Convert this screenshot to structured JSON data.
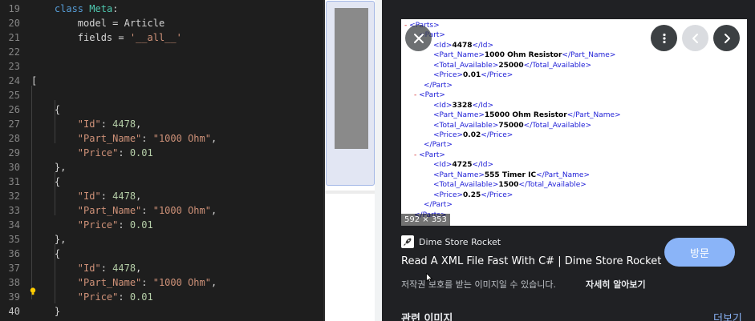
{
  "editor": {
    "lines": [
      {
        "no": "19",
        "indent": "    ",
        "tokens": [
          {
            "t": "class ",
            "c": "kw"
          },
          {
            "t": "Meta",
            "c": "cls"
          },
          {
            "t": ":",
            "c": ""
          }
        ]
      },
      {
        "no": "20",
        "indent": "        ",
        "tokens": [
          {
            "t": "model = Article",
            "c": ""
          }
        ]
      },
      {
        "no": "21",
        "indent": "        ",
        "tokens": [
          {
            "t": "fields = ",
            "c": ""
          },
          {
            "t": "'__all__'",
            "c": "str"
          }
        ]
      },
      {
        "no": "22",
        "indent": "",
        "tokens": []
      },
      {
        "no": "23",
        "indent": "",
        "tokens": []
      },
      {
        "no": "24",
        "indent": "",
        "tokens": [
          {
            "t": "[",
            "c": ""
          }
        ]
      },
      {
        "no": "25",
        "indent": "",
        "tokens": []
      },
      {
        "no": "26",
        "indent": "    ",
        "tokens": [
          {
            "t": "{",
            "c": ""
          }
        ]
      },
      {
        "no": "27",
        "indent": "        ",
        "tokens": [
          {
            "t": "\"Id\"",
            "c": "str"
          },
          {
            "t": ": ",
            "c": ""
          },
          {
            "t": "4478",
            "c": "num"
          },
          {
            "t": ",",
            "c": ""
          }
        ]
      },
      {
        "no": "28",
        "indent": "        ",
        "tokens": [
          {
            "t": "\"Part_Name\"",
            "c": "str"
          },
          {
            "t": ": ",
            "c": ""
          },
          {
            "t": "\"1000 Ohm\"",
            "c": "str"
          },
          {
            "t": ",",
            "c": ""
          }
        ]
      },
      {
        "no": "29",
        "indent": "        ",
        "tokens": [
          {
            "t": "\"Price\"",
            "c": "str"
          },
          {
            "t": ": ",
            "c": ""
          },
          {
            "t": "0.01",
            "c": "num"
          }
        ]
      },
      {
        "no": "30",
        "indent": "    ",
        "tokens": [
          {
            "t": "},",
            "c": ""
          }
        ]
      },
      {
        "no": "31",
        "indent": "    ",
        "tokens": [
          {
            "t": "{",
            "c": ""
          }
        ]
      },
      {
        "no": "32",
        "indent": "        ",
        "tokens": [
          {
            "t": "\"Id\"",
            "c": "str"
          },
          {
            "t": ": ",
            "c": ""
          },
          {
            "t": "4478",
            "c": "num"
          },
          {
            "t": ",",
            "c": ""
          }
        ]
      },
      {
        "no": "33",
        "indent": "        ",
        "tokens": [
          {
            "t": "\"Part_Name\"",
            "c": "str"
          },
          {
            "t": ": ",
            "c": ""
          },
          {
            "t": "\"1000 Ohm\"",
            "c": "str"
          },
          {
            "t": ",",
            "c": ""
          }
        ]
      },
      {
        "no": "34",
        "indent": "        ",
        "tokens": [
          {
            "t": "\"Price\"",
            "c": "str"
          },
          {
            "t": ": ",
            "c": ""
          },
          {
            "t": "0.01",
            "c": "num"
          }
        ]
      },
      {
        "no": "35",
        "indent": "    ",
        "tokens": [
          {
            "t": "},",
            "c": ""
          }
        ]
      },
      {
        "no": "36",
        "indent": "    ",
        "tokens": [
          {
            "t": "{",
            "c": ""
          }
        ]
      },
      {
        "no": "37",
        "indent": "        ",
        "tokens": [
          {
            "t": "\"Id\"",
            "c": "str"
          },
          {
            "t": ": ",
            "c": ""
          },
          {
            "t": "4478",
            "c": "num"
          },
          {
            "t": ",",
            "c": ""
          }
        ]
      },
      {
        "no": "38",
        "indent": "        ",
        "tokens": [
          {
            "t": "\"Part_Name\"",
            "c": "str"
          },
          {
            "t": ": ",
            "c": ""
          },
          {
            "t": "\"1000 Ohm\"",
            "c": "str"
          },
          {
            "t": ",",
            "c": ""
          }
        ]
      },
      {
        "no": "39",
        "indent": "        ",
        "tokens": [
          {
            "t": "\"Price\"",
            "c": "str"
          },
          {
            "t": ": ",
            "c": ""
          },
          {
            "t": "0.01",
            "c": "num"
          }
        ]
      },
      {
        "no": "40",
        "indent": "    ",
        "tokens": [
          {
            "t": "}",
            "c": ""
          }
        ]
      },
      {
        "no": "41",
        "indent": "",
        "tokens": [
          {
            "t": "]",
            "c": ""
          }
        ]
      }
    ],
    "active_line": "40",
    "colors": {
      "background": "#1e1e1e",
      "keyword": "#569cd6",
      "class": "#4ec9b0",
      "string": "#ce9178",
      "number": "#b5cea8"
    }
  },
  "preview": {
    "xml_lines": [
      {
        "dash": "- ",
        "open": "<Parts>",
        "value": "",
        "close": ""
      },
      {
        "dash": "- ",
        "open": "<Part>",
        "value": "",
        "close": ""
      },
      {
        "dash": "",
        "open": "<Id>",
        "value": "4478",
        "close": "</Id>"
      },
      {
        "dash": "",
        "open": "<Part_Name>",
        "value": "1000 Ohm Resistor",
        "close": "</Part_Name>"
      },
      {
        "dash": "",
        "open": "<Total_Available>",
        "value": "25000",
        "close": "</Total_Available>"
      },
      {
        "dash": "",
        "open": "<Price>",
        "value": "0.01",
        "close": "</Price>"
      },
      {
        "dash": "",
        "open": "</Part>",
        "value": "",
        "close": ""
      },
      {
        "dash": "- ",
        "open": "<Part>",
        "value": "",
        "close": ""
      },
      {
        "dash": "",
        "open": "<Id>",
        "value": "3328",
        "close": "</Id>"
      },
      {
        "dash": "",
        "open": "<Part_Name>",
        "value": "15000 Ohm Resistor",
        "close": "</Part_Name>"
      },
      {
        "dash": "",
        "open": "<Total_Available>",
        "value": "75000",
        "close": "</Total_Available>"
      },
      {
        "dash": "",
        "open": "<Price>",
        "value": "0.02",
        "close": "</Price>"
      },
      {
        "dash": "",
        "open": "</Part>",
        "value": "",
        "close": ""
      },
      {
        "dash": "- ",
        "open": "<Part>",
        "value": "",
        "close": ""
      },
      {
        "dash": "",
        "open": "<Id>",
        "value": "4725",
        "close": "</Id>"
      },
      {
        "dash": "",
        "open": "<Part_Name>",
        "value": "555 Timer IC",
        "close": "</Part_Name>"
      },
      {
        "dash": "",
        "open": "<Total_Available>",
        "value": "1500",
        "close": "</Total_Available>"
      },
      {
        "dash": "",
        "open": "<Price>",
        "value": "0.25",
        "close": "</Price>"
      },
      {
        "dash": "",
        "open": "</Part>",
        "value": "",
        "close": ""
      },
      {
        "dash": "",
        "open": "</Parts>",
        "value": "",
        "close": ""
      }
    ],
    "dimensions": "592 × 353"
  },
  "source": {
    "name": "Dime Store Rocket",
    "title": "Read A XML File Fast With C# | Dime Store Rocket",
    "visit_label": "방문",
    "copyright_notice": "저작권 보호를 받는 이미지일 수 있습니다.",
    "learn_more": "자세히 알아보기"
  },
  "related": {
    "heading": "관련 이미지",
    "more": "더보기"
  },
  "icons": {
    "close": "close-icon",
    "more": "more-vert-icon",
    "prev": "chevron-left-icon",
    "next": "chevron-right-icon",
    "lightbulb": "lightbulb-icon"
  },
  "accent_color": "#8ab4f8"
}
